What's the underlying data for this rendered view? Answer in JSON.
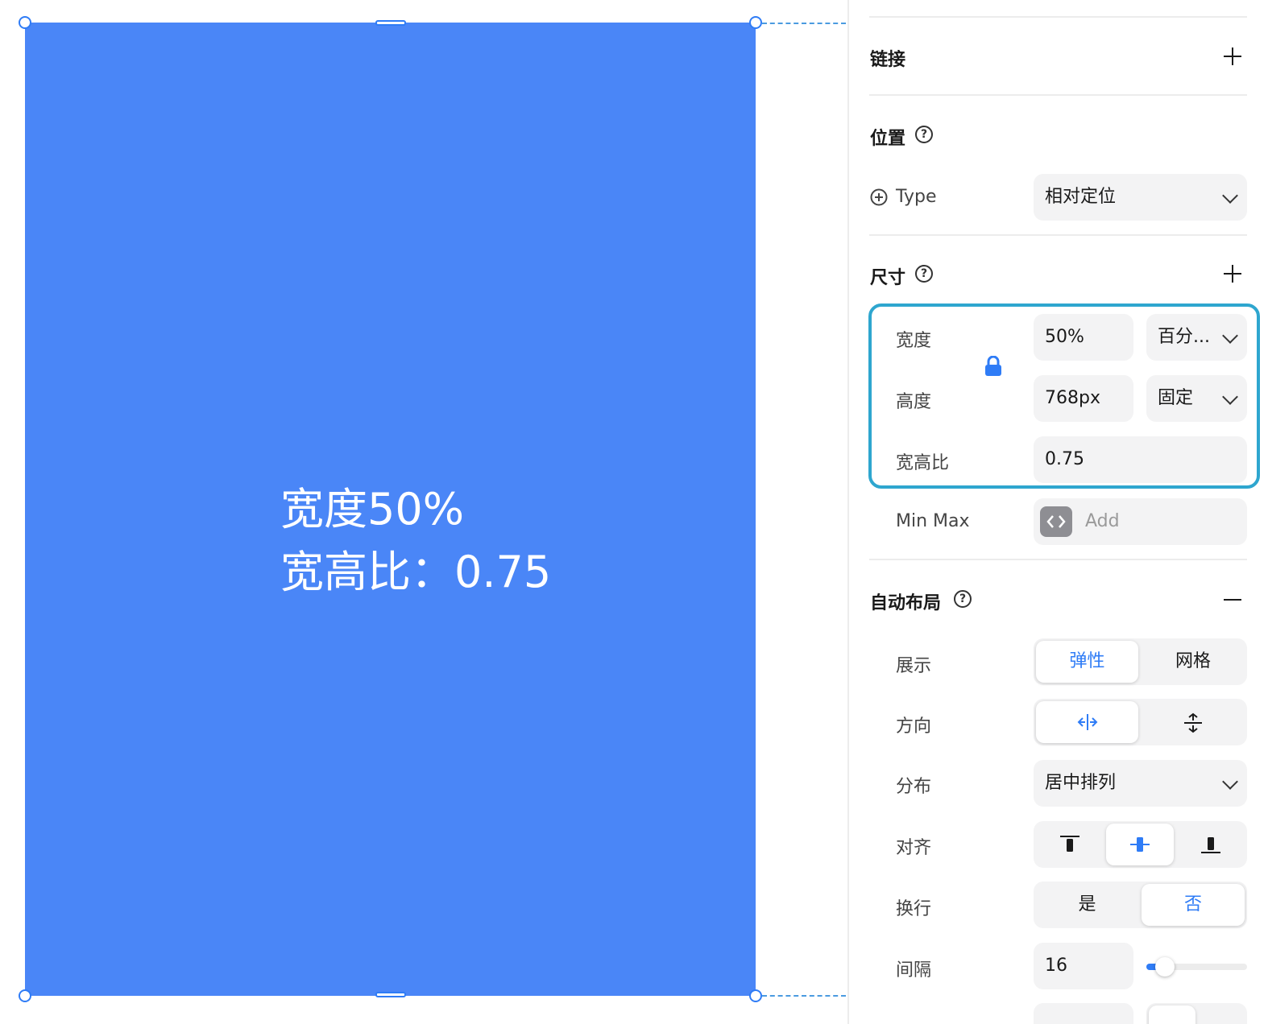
{
  "canvas": {
    "frame_text_line1": "宽度50%",
    "frame_text_line2": "宽高比：0.75",
    "frame_color": "#4a86f7"
  },
  "panel": {
    "link": {
      "title": "链接"
    },
    "position": {
      "title": "位置",
      "type_label": "Type",
      "type_value": "相对定位"
    },
    "size": {
      "title": "尺寸",
      "width_label": "宽度",
      "width_value": "50%",
      "width_unit": "百分...",
      "height_label": "高度",
      "height_value": "768px",
      "height_unit": "固定",
      "ratio_label": "宽高比",
      "ratio_value": "0.75",
      "minmax_label": "Min Max",
      "minmax_placeholder": "Add"
    },
    "autolayout": {
      "title": "自动布局",
      "display_label": "展示",
      "display_options": [
        "弹性",
        "网格"
      ],
      "direction_label": "方向",
      "distribution_label": "分布",
      "distribution_value": "居中排列",
      "align_label": "对齐",
      "wrap_label": "换行",
      "wrap_options": [
        "是",
        "否"
      ],
      "gap_label": "间隔",
      "gap_value": "16",
      "gap_level": 0.12
    },
    "accent_color": "#2f7cf6",
    "highlight_color": "#2ea6cf"
  }
}
